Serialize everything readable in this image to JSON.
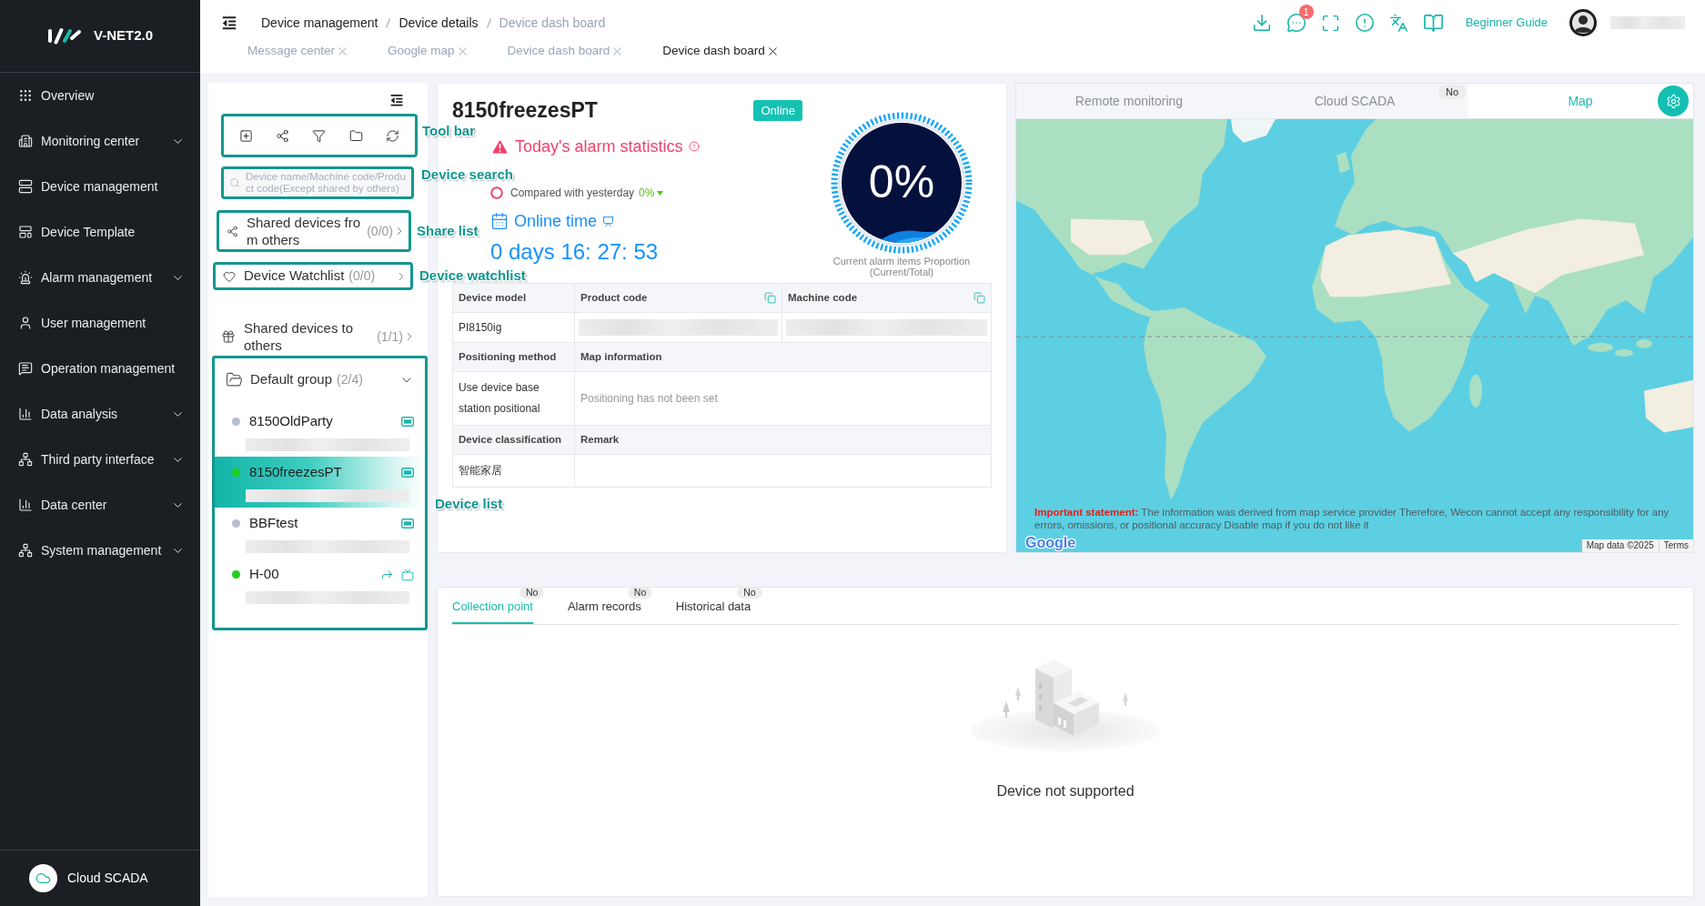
{
  "sidebar": {
    "logo": "V-NET2.0",
    "items": [
      {
        "label": "Overview",
        "expandable": false
      },
      {
        "label": "Monitoring center",
        "expandable": true
      },
      {
        "label": "Device management",
        "expandable": false
      },
      {
        "label": "Device Template",
        "expandable": false
      },
      {
        "label": "Alarm management",
        "expandable": true
      },
      {
        "label": "User management",
        "expandable": false
      },
      {
        "label": "Operation management",
        "expandable": false
      },
      {
        "label": "Data analysis",
        "expandable": true
      },
      {
        "label": "Third party interface",
        "expandable": true
      },
      {
        "label": "Data center",
        "expandable": true
      },
      {
        "label": "System management",
        "expandable": true
      }
    ],
    "footer": "Cloud SCADA"
  },
  "header": {
    "breadcrumb": [
      {
        "label": "Device management",
        "current": false
      },
      {
        "label": "Device details",
        "current": false
      },
      {
        "label": "Device dash board",
        "current": true
      }
    ],
    "tabs": [
      {
        "label": "Message center",
        "selected": false
      },
      {
        "label": "Google map",
        "selected": false
      },
      {
        "label": "Device dash board",
        "selected": false
      },
      {
        "label": "Device dash board",
        "selected": true
      }
    ],
    "message_badge": "1",
    "guide": "Beginner Guide"
  },
  "device_panel": {
    "search": {
      "placeholder": "Device name/Machine code/Product code(Except shared by others)"
    },
    "shared_from_others": {
      "label": "Shared devices from others",
      "count": "(0/0)"
    },
    "watchlist": {
      "label": "Device Watchlist",
      "count": "(0/0)"
    },
    "shared_to_others": {
      "label": "Shared devices to others",
      "count": "(1/1)"
    },
    "group": {
      "label": "Default group",
      "count": "(2/4)",
      "expanded": true,
      "devices": [
        {
          "name": "8150OldParty",
          "online": false,
          "selected": false,
          "shared": false
        },
        {
          "name": "8150freezesPT",
          "online": true,
          "selected": true,
          "shared": false
        },
        {
          "name": "BBFtest",
          "online": false,
          "selected": false,
          "shared": false
        },
        {
          "name": "H-00",
          "online": true,
          "selected": false,
          "shared": true
        }
      ]
    }
  },
  "annotations": [
    {
      "label": "Tool bar"
    },
    {
      "label": "Device search"
    },
    {
      "label": "Share list"
    },
    {
      "label": "Device watchlist"
    },
    {
      "label": "Device list"
    }
  ],
  "device": {
    "name": "8150freezesPT",
    "status": "Online",
    "online": true,
    "alarm_title": "Today's alarm statistics",
    "compare_label": "Compared with yesterday",
    "compare_value": "0%",
    "falling": true,
    "online_title": "Online time",
    "online_duration": "0 days 16: 27: 53",
    "gauge": {
      "value": "0%",
      "caption": "Current alarm items Proportion (Current/Total)"
    },
    "info_table": [
      {
        "kind": "header",
        "cells": [
          {
            "text": "Device model",
            "copyable": false
          },
          {
            "text": "Product code",
            "copyable": true
          },
          {
            "text": "Machine code",
            "copyable": true
          }
        ]
      },
      {
        "kind": "value",
        "cells": [
          {
            "kind": "text",
            "text": "PI8150ig"
          },
          {
            "kind": "redacted"
          },
          {
            "kind": "redacted"
          }
        ]
      },
      {
        "kind": "header",
        "cells": [
          {
            "text": "Positioning method",
            "copyable": false
          },
          {
            "text": "Map information",
            "copyable": false
          }
        ]
      },
      {
        "kind": "value",
        "cells": [
          {
            "kind": "text",
            "text": "Use device base station positional"
          },
          {
            "kind": "note",
            "text": "Positioning has not been set"
          }
        ]
      },
      {
        "kind": "header",
        "cells": [
          {
            "text": "Device classification",
            "copyable": false
          },
          {
            "text": "Remark",
            "copyable": false
          }
        ]
      },
      {
        "kind": "value",
        "cells": [
          {
            "kind": "text",
            "text": "智能家居"
          }
        ]
      }
    ]
  },
  "map_panel": {
    "tabs": [
      {
        "label": "Remote monitoring",
        "selected": false
      },
      {
        "label": "Cloud SCADA",
        "selected": false,
        "badge": "No"
      },
      {
        "label": "Map",
        "selected": true
      }
    ],
    "statement": "**Important statement:** The information was derived from map service provider Therefore, Wecon cannot accept any responsibility for any errors, omissions, or positional accuracy Disable map if you do not like it",
    "map_logo": "Google",
    "map_data": "Map data ©2025",
    "terms": "Terms"
  },
  "detail_panel": {
    "tabs": [
      {
        "label": "Collection point",
        "selected": true,
        "badge": "No"
      },
      {
        "label": "Alarm records",
        "selected": false,
        "badge": "No"
      },
      {
        "label": "Historical data",
        "selected": false,
        "badge": "No"
      }
    ],
    "empty_message": "Device not supported"
  }
}
